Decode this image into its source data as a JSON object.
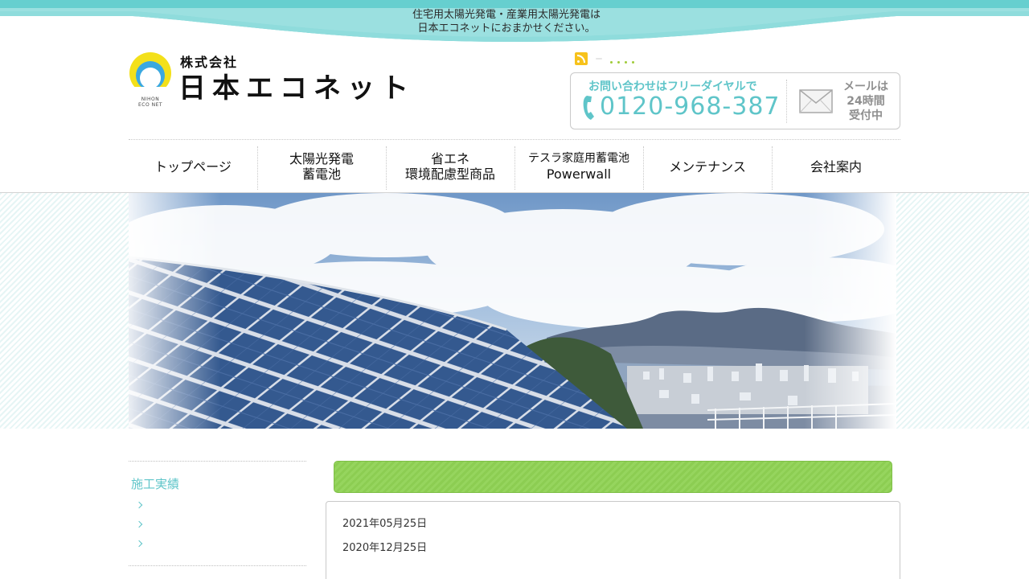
{
  "banner": {
    "tagline_line1": "住宅用太陽光発電・産業用太陽光発電は",
    "tagline_line2": "日本エコネットにおまかせください。",
    "color": "#66cfcf"
  },
  "logo": {
    "kabushiki": "株式会社",
    "name": "日本エコネット",
    "sub_line1": "NIHON",
    "sub_line2": "ECO NET"
  },
  "utility": {
    "rss_icon": "rss-icon",
    "tag": "",
    "links": [
      "",
      "",
      "",
      ""
    ]
  },
  "contact": {
    "lead": "お問い合わせはフリーダイヤルで",
    "phone": "0120-968-387",
    "mail_line1": "メールは",
    "mail_line2": "24時間",
    "mail_line3": "受付中",
    "accent": "#5fc5c9"
  },
  "nav": {
    "items": [
      {
        "line1": "トップページ",
        "line2": ""
      },
      {
        "line1": "太陽光発電",
        "line2": "蓄電池"
      },
      {
        "line1": "省エネ",
        "line2": "環境配慮型商品"
      },
      {
        "line1": "テスラ家庭用蓄電池",
        "line2": "Powerwall"
      },
      {
        "line1": "メンテナンス",
        "line2": ""
      },
      {
        "line1": "会社案内",
        "line2": ""
      }
    ]
  },
  "sidebar": {
    "title": "施工実績",
    "links": [
      "",
      "",
      ""
    ]
  },
  "main": {
    "heading": "",
    "news": [
      {
        "date": "2021年05月25日",
        "title": ""
      },
      {
        "date": "2020年12月25日",
        "title": ""
      }
    ]
  }
}
